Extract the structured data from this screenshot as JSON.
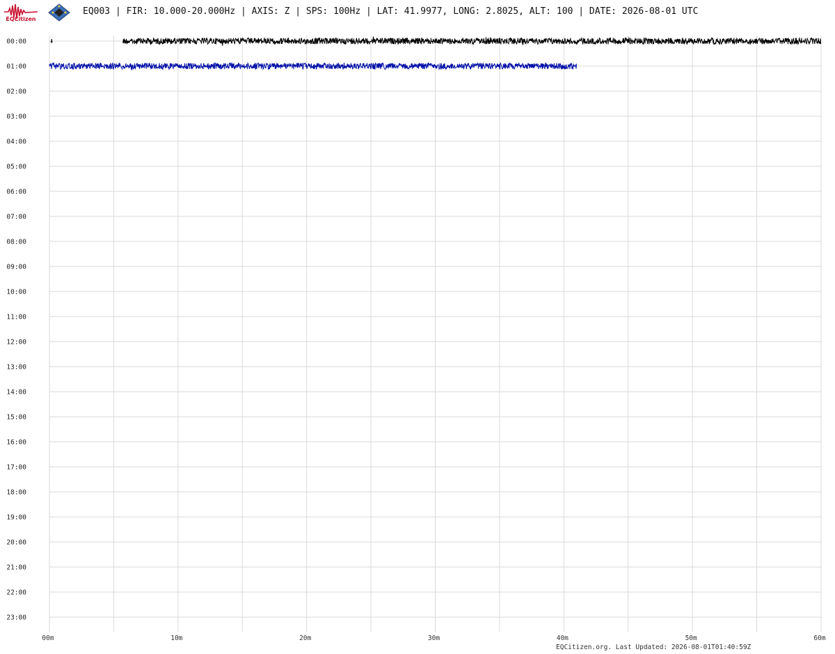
{
  "header": {
    "logo_text": "EQCitizen",
    "title": "EQ003 | FIR: 10.000-20.000Hz | AXIS: Z | SPS: 100Hz | LAT: 41.9977, LONG: 2.8025, ALT: 100 | DATE: 2026-08-01 UTC"
  },
  "footer": {
    "text": "EQCitizen.org. Last Updated: 2026-08-01T01:40:59Z"
  },
  "colors": {
    "grid": "#d9d9d9",
    "row0": "#000000",
    "row1": "#0010a8",
    "logo": "#c8102e"
  },
  "chart_data": {
    "type": "line",
    "title": "",
    "xlabel": "",
    "ylabel": "",
    "x_ticks": [
      "00m",
      "10m",
      "20m",
      "30m",
      "40m",
      "50m",
      "60m"
    ],
    "xlim": [
      0,
      60
    ],
    "rows": [
      "00:00",
      "01:00",
      "02:00",
      "03:00",
      "04:00",
      "05:00",
      "06:00",
      "07:00",
      "08:00",
      "09:00",
      "10:00",
      "11:00",
      "12:00",
      "13:00",
      "14:00",
      "15:00",
      "16:00",
      "17:00",
      "18:00",
      "19:00",
      "20:00",
      "21:00",
      "22:00",
      "23:00"
    ],
    "grid": true,
    "series": [
      {
        "row": "00:00",
        "color": "#000000",
        "segments": [
          [
            0.1,
            0.25
          ],
          [
            5.7,
            60.0
          ]
        ]
      },
      {
        "row": "01:00",
        "color": "#0010a8",
        "segments": [
          [
            0.0,
            41.0
          ]
        ]
      }
    ]
  }
}
